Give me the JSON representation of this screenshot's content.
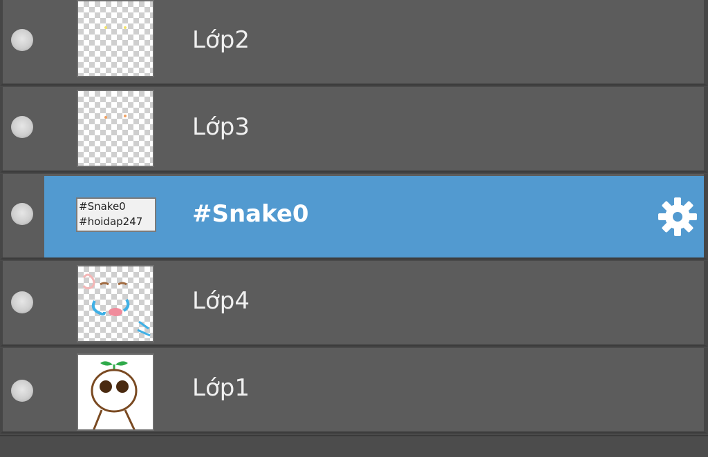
{
  "layers": [
    {
      "name": "Lớp2",
      "thumb": "transparent-dots-yellow"
    },
    {
      "name": "Lớp3",
      "thumb": "transparent-dots-orange"
    },
    {
      "name": "#Snake0",
      "selected": true,
      "thumb_lines": [
        "#Snake0",
        "#hoidap247"
      ],
      "options_icon": "gear-icon"
    },
    {
      "name": "Lớp4",
      "thumb": "transparent-face-sketch"
    },
    {
      "name": "Lớp1",
      "thumb": "white-sprout-character"
    }
  ],
  "colors": {
    "selected_row": "#529ad0",
    "row": "#5c5c5c",
    "panel": "#4a4a4a"
  }
}
